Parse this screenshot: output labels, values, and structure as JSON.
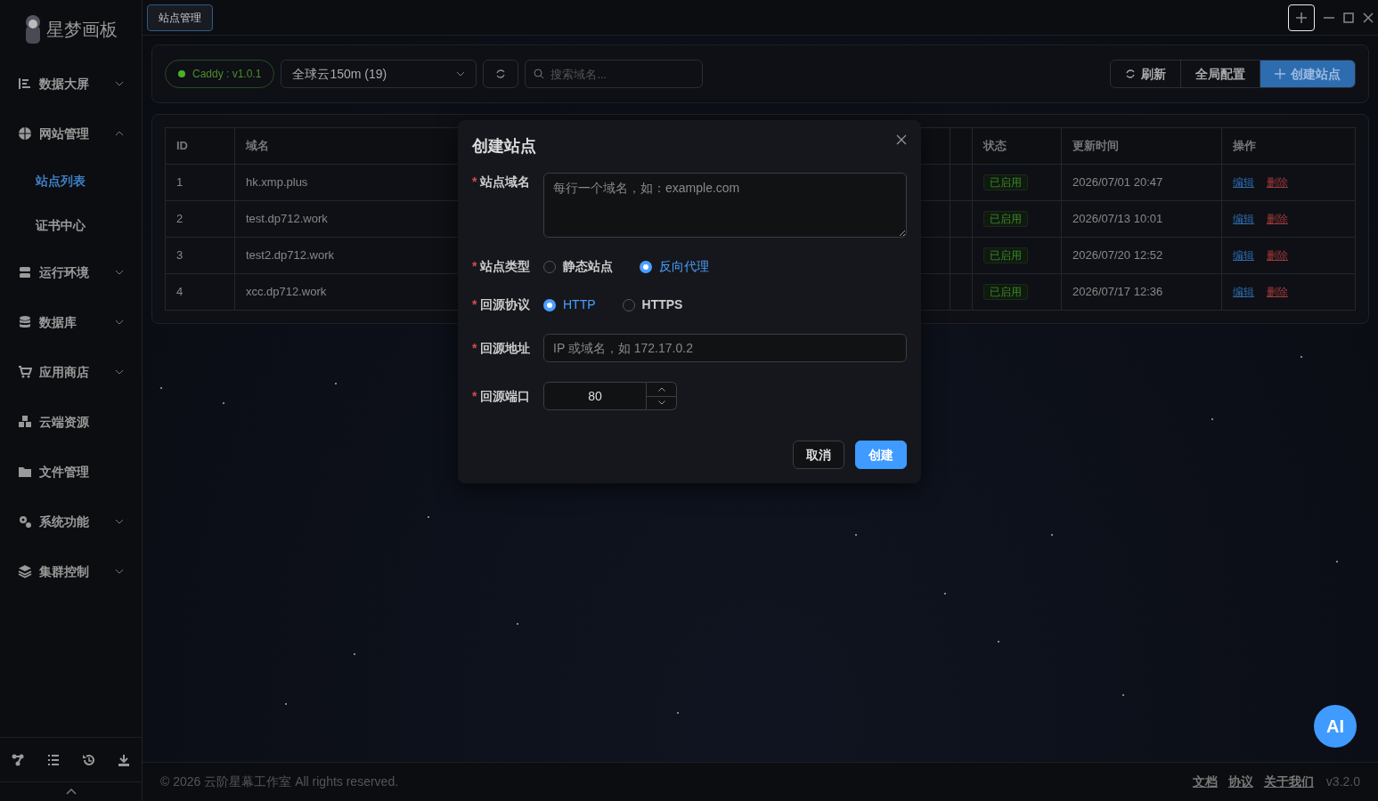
{
  "sidebar": {
    "logo_text": "星梦画板",
    "items": [
      {
        "label": "数据大屏",
        "expanded": false
      },
      {
        "label": "网站管理",
        "expanded": true,
        "children": [
          {
            "label": "站点列表",
            "selected": true
          },
          {
            "label": "证书中心",
            "selected": false
          }
        ]
      },
      {
        "label": "运行环境",
        "expanded": false
      },
      {
        "label": "数据库",
        "expanded": false
      },
      {
        "label": "应用商店",
        "expanded": false
      },
      {
        "label": "云端资源"
      },
      {
        "label": "文件管理"
      },
      {
        "label": "系统功能",
        "expanded": false
      },
      {
        "label": "集群控制",
        "expanded": false
      }
    ]
  },
  "tabs": [
    {
      "label": "站点管理",
      "selected": true
    }
  ],
  "toolbar": {
    "server_badge": "Caddy : v1.0.1",
    "server_select": "全球云150m (19)",
    "search": {
      "placeholder": "搜索域名..."
    },
    "buttons": [
      {
        "label": "刷新",
        "kind": "refresh"
      },
      {
        "label": "全局配置",
        "kind": "plain"
      },
      {
        "label": "创建站点",
        "kind": "primary"
      }
    ]
  },
  "table": {
    "columns": [
      "ID",
      "域名",
      "状态",
      "更新时间",
      "操作"
    ],
    "rows": [
      {
        "id": "1",
        "domain": "hk.xmp.plus",
        "status": "已启用",
        "updated": "2026/07/01 20:47",
        "actions": [
          "编辑",
          "删除"
        ]
      },
      {
        "id": "2",
        "domain": "test.dp712.work",
        "status": "已启用",
        "updated": "2026/07/13 10:01",
        "actions": [
          "编辑",
          "删除"
        ]
      },
      {
        "id": "3",
        "domain": "test2.dp712.work",
        "status": "已启用",
        "updated": "2026/07/20 12:52",
        "actions": [
          "编辑",
          "删除"
        ]
      },
      {
        "id": "4",
        "domain": "xcc.dp712.work",
        "status": "已启用",
        "updated": "2026/07/17 12:36",
        "actions": [
          "编辑",
          "删除"
        ]
      }
    ]
  },
  "dialog": {
    "title": "创建站点",
    "fields": [
      {
        "kind": "textarea",
        "label": "站点域名",
        "required_mark": "*",
        "placeholder": "每行一个域名，如：example.com"
      },
      {
        "kind": "radio",
        "label": "站点类型",
        "required_mark": "*",
        "options": [
          {
            "label": "静态站点",
            "selected": false
          },
          {
            "label": "反向代理",
            "selected": true
          }
        ]
      },
      {
        "kind": "radio",
        "label": "回源协议",
        "required_mark": "*",
        "options": [
          {
            "label": "HTTP",
            "selected": true
          },
          {
            "label": "HTTPS",
            "selected": false
          }
        ]
      },
      {
        "kind": "input",
        "label": "回源地址",
        "required_mark": "*",
        "placeholder": "IP 或域名，如 172.17.0.2"
      },
      {
        "kind": "number",
        "label": "回源端口",
        "required_mark": "*",
        "value": "80"
      }
    ],
    "buttons": [
      {
        "label": "取消",
        "kind": "plain"
      },
      {
        "label": "创建",
        "kind": "primary"
      }
    ]
  },
  "ai_button": "AI",
  "footer": {
    "copyright": "© 2026 云阶星幕工作室 All rights reserved.",
    "links": [
      "文档",
      "协议",
      "关于我们"
    ],
    "version": "v3.2.0"
  }
}
